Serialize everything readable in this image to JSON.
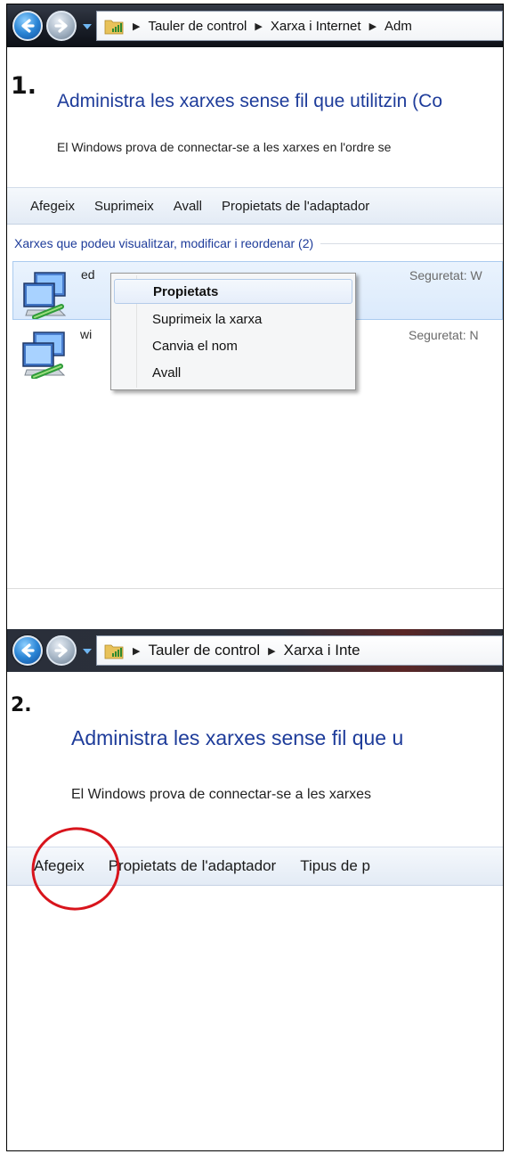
{
  "panel1": {
    "step": "1.",
    "breadcrumb": [
      "Tauler de control",
      "Xarxa i Internet",
      "Adm"
    ],
    "title": "Administra les xarxes sense fil que utilitzin (Co",
    "description": "El Windows prova de connectar-se a les xarxes en l'ordre se",
    "toolbar": [
      "Afegeix",
      "Suprimeix",
      "Avall",
      "Propietats de l'adaptador"
    ],
    "group_header": "Xarxes que podeu visualitzar, modificar i reordenar (2)",
    "networks": [
      {
        "name": "ed",
        "security": "Seguretat: W",
        "selected": true
      },
      {
        "name": "wi",
        "security": "Seguretat: N",
        "selected": false
      }
    ],
    "context_menu": [
      {
        "label": "Propietats",
        "default": true
      },
      {
        "label": "Suprimeix la xarxa",
        "default": false
      },
      {
        "label": "Canvia el nom",
        "default": false
      },
      {
        "label": "Avall",
        "default": false
      }
    ]
  },
  "panel2": {
    "step": "2.",
    "breadcrumb": [
      "Tauler de control",
      "Xarxa i Inte"
    ],
    "title": "Administra les xarxes sense fil que u",
    "description": "El Windows prova de connectar-se a les xarxes",
    "toolbar": [
      "Afegeix",
      "Propietats de l'adaptador",
      "Tipus de p"
    ],
    "highlight_color": "#d8141c"
  },
  "colors": {
    "title": "#1e3c9a",
    "selection": "#dbeafc"
  },
  "icons": [
    "back-arrow-icon",
    "forward-arrow-icon",
    "network-folder-icon",
    "wireless-network-icon"
  ]
}
